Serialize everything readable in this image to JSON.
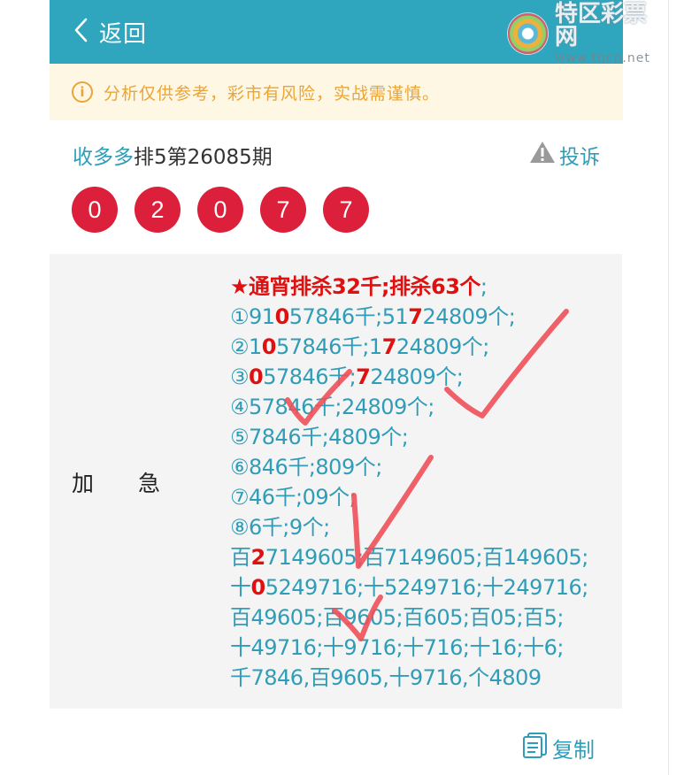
{
  "header": {
    "back_label": "返回",
    "logo_name": "特区彩票网",
    "logo_url": "www.tqcp.net"
  },
  "notice": {
    "icon": "info-icon",
    "text": "分析仅供参考，彩市有风险，实战需谨慎。"
  },
  "post": {
    "author": "收多多",
    "issue": "排5第26085期",
    "complain_label": "投诉",
    "numbers": [
      "0",
      "2",
      "0",
      "7",
      "7"
    ]
  },
  "panel": {
    "label_a": "加",
    "label_b": "急",
    "lines": [
      [
        {
          "t": "★通宵排杀32千;排杀63个",
          "c": "headline"
        },
        {
          "t": ";",
          "c": ""
        }
      ],
      [
        {
          "t": "①91",
          "c": ""
        },
        {
          "t": "0",
          "c": "red"
        },
        {
          "t": "57846千;51",
          "c": ""
        },
        {
          "t": "7",
          "c": "red"
        },
        {
          "t": "24809个;",
          "c": ""
        }
      ],
      [
        {
          "t": "②1",
          "c": ""
        },
        {
          "t": "0",
          "c": "red"
        },
        {
          "t": "57846千;1",
          "c": ""
        },
        {
          "t": "7",
          "c": "red"
        },
        {
          "t": "24809个;",
          "c": ""
        }
      ],
      [
        {
          "t": "③",
          "c": ""
        },
        {
          "t": "0",
          "c": "red"
        },
        {
          "t": "57846千;",
          "c": ""
        },
        {
          "t": "7",
          "c": "red"
        },
        {
          "t": "24809个;",
          "c": ""
        }
      ],
      [
        {
          "t": "④57846千;24809个;",
          "c": ""
        }
      ],
      [
        {
          "t": "⑤7846千;4809个;",
          "c": ""
        }
      ],
      [
        {
          "t": "⑥846千;809个;",
          "c": ""
        }
      ],
      [
        {
          "t": "⑦46千;09个;",
          "c": ""
        }
      ],
      [
        {
          "t": "⑧6千;9个;",
          "c": ""
        }
      ],
      [
        {
          "t": "百",
          "c": ""
        },
        {
          "t": "2",
          "c": "red"
        },
        {
          "t": "7149605;百7149605;百149605;",
          "c": ""
        }
      ],
      [
        {
          "t": "十",
          "c": ""
        },
        {
          "t": "0",
          "c": "red"
        },
        {
          "t": "5249716;十5249716;十249716;",
          "c": ""
        }
      ],
      [
        {
          "t": "百49605;百9605;百605;百05;百5;",
          "c": ""
        }
      ],
      [
        {
          "t": "十49716;十9716;十716;十16;十6;",
          "c": ""
        }
      ],
      [
        {
          "t": "千7846,百9605,十9716,个4809",
          "c": ""
        }
      ]
    ]
  },
  "footer": {
    "copy_label": "复制"
  },
  "colors": {
    "header_bg": "#2fa6bd",
    "accent": "#2f9db8",
    "ball": "#dc1f3a",
    "highlight": "#e01010",
    "notice_text": "#e9a53a",
    "check_marks": "#f0505a"
  }
}
